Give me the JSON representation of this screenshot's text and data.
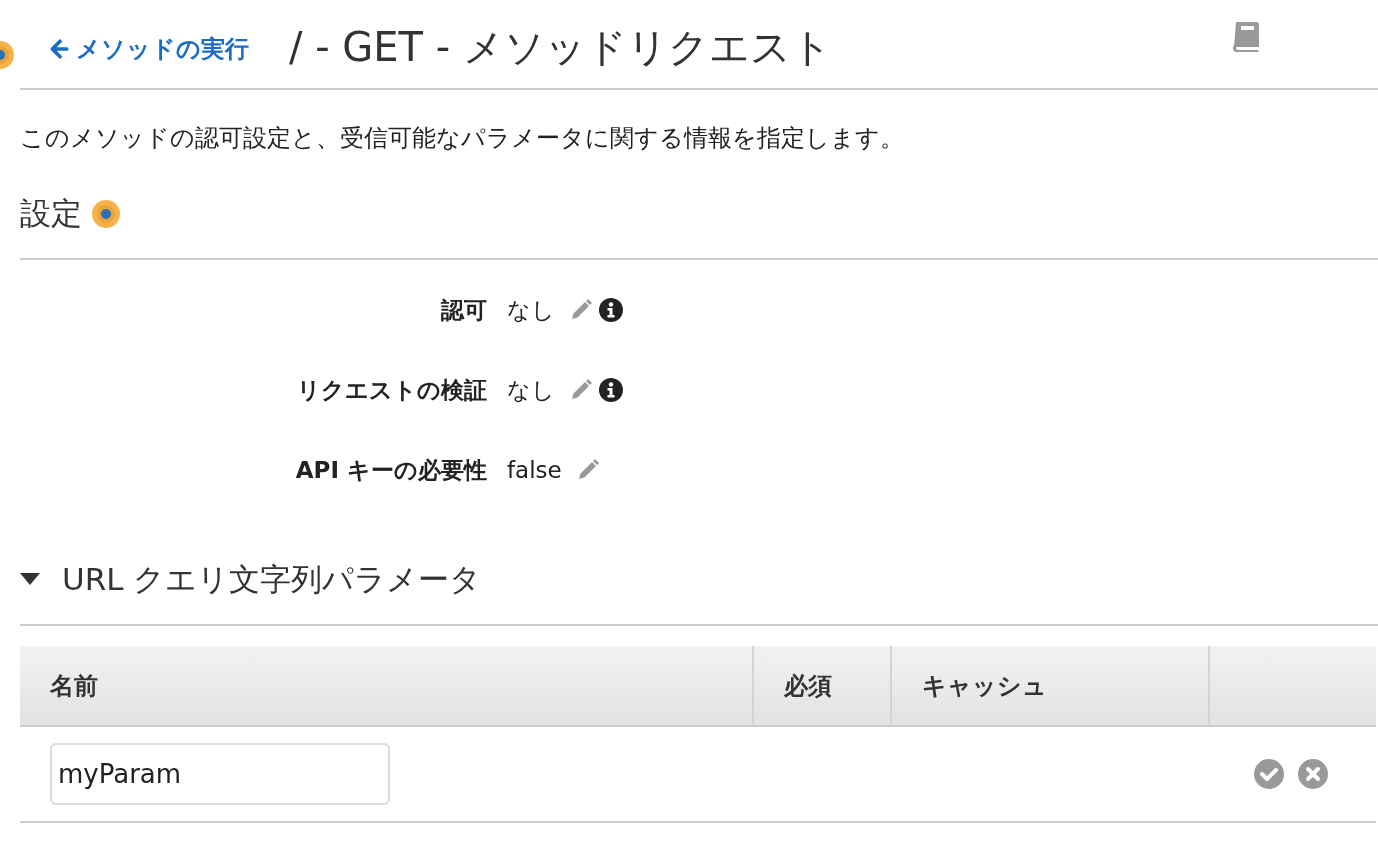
{
  "header": {
    "back_link": "メソッドの実行",
    "title": "/ - GET - メソッドリクエスト"
  },
  "description": "このメソッドの認可設定と、受信可能なパラメータに関する情報を指定します。",
  "settings": {
    "heading": "設定",
    "rows": [
      {
        "label": "認可",
        "value": "なし",
        "info": true
      },
      {
        "label": "リクエストの検証",
        "value": "なし",
        "info": true
      },
      {
        "label": "API キーの必要性",
        "value": "false",
        "info": false
      }
    ]
  },
  "query_params": {
    "heading": "URL クエリ文字列パラメータ",
    "expanded": true,
    "columns": [
      "名前",
      "必須",
      "キャッシュ"
    ],
    "rows": [
      {
        "name": "myParam"
      }
    ]
  }
}
